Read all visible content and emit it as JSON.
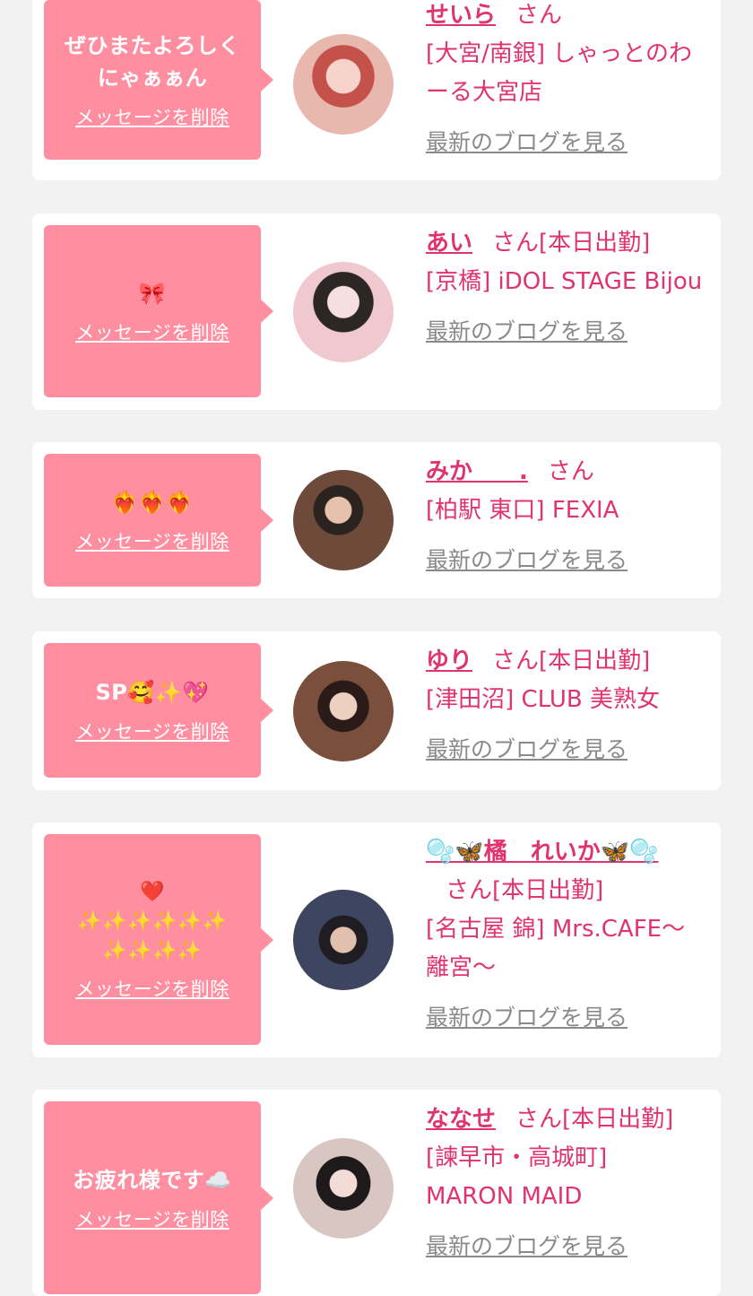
{
  "delete_label": "メッセージを削除",
  "san_label": "さん",
  "blog_label": "最新のブログを見る",
  "entries": [
    {
      "message": "ぜひまたよろしく\nにゃぁぁん",
      "name": "せいら",
      "status": "",
      "shop": "[大宮/南銀] しゃっとのわーる大宮店"
    },
    {
      "message": "🎀",
      "name": "あい",
      "status": "[本日出勤]",
      "shop": "[京橋] iDOL STAGE Bijou"
    },
    {
      "message": "❤️‍🔥❤️‍🔥❤️‍🔥",
      "name": "みか　　.",
      "status": "",
      "shop": "[柏駅 東口] FEXIA"
    },
    {
      "message": "SP🥰✨💖",
      "name": "ゆり",
      "status": "[本日出勤]",
      "shop": "[津田沼] CLUB 美熟女"
    },
    {
      "message": "❤️\n✨✨✨✨✨✨\n✨✨✨✨",
      "name": "🫧🦋橘　れいか🦋🫧",
      "status": "[本日出勤]",
      "shop": "[名古屋 錦] Mrs.CAFE〜離宮〜"
    },
    {
      "message": "お疲れ様です☁️",
      "name": "ななせ",
      "status": "[本日出勤]",
      "shop": "[諫早市・高城町] MARON MAID"
    }
  ],
  "colors": {
    "bubble": "#ff8fa0",
    "accent": "#e0346c",
    "muted": "#8a8a8a",
    "background": "#f2f2f2"
  }
}
